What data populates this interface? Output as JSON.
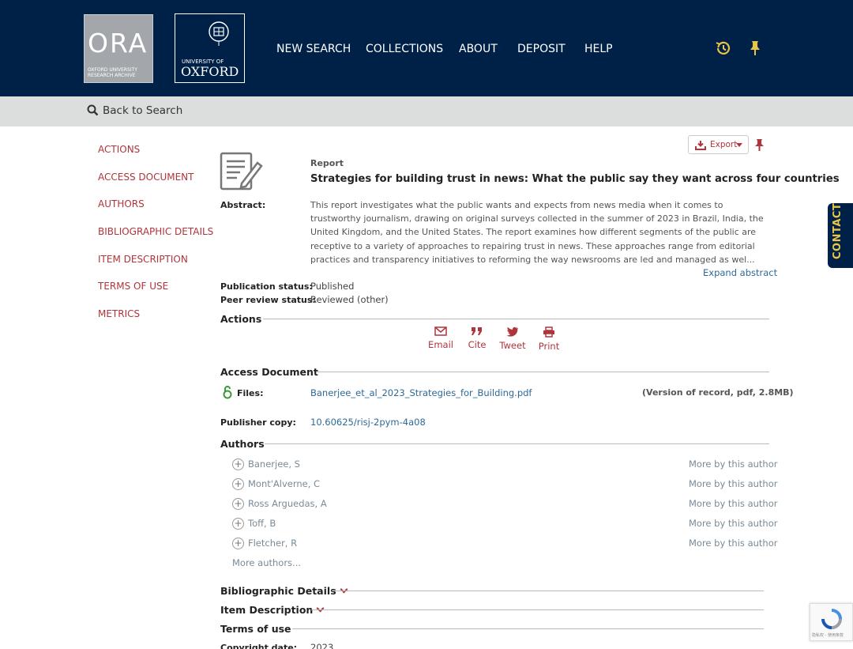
{
  "header": {
    "ora_logo_text": "ORA",
    "ora_logo_subtitle": "OXFORD UNIVERSITY RESEARCH ARCHIVE",
    "oxford_logo_small": "UNIVERSITY OF",
    "oxford_logo_big": "OXFORD",
    "nav": [
      "NEW SEARCH",
      "COLLECTIONS",
      "ABOUT",
      "DEPOSIT",
      "HELP"
    ],
    "icons": [
      "history-icon",
      "pin-icon"
    ],
    "colors": {
      "background": "#002147",
      "icon": "#e8c547"
    }
  },
  "backbar": {
    "label": "Back to Search"
  },
  "sidebar": {
    "items": [
      "ACTIONS",
      "ACCESS DOCUMENT",
      "AUTHORS",
      "BIBLIOGRAPHIC DETAILS",
      "ITEM DESCRIPTION",
      "TERMS OF USE",
      "METRICS"
    ]
  },
  "record": {
    "export_label": "Export",
    "type": "Report",
    "title": "Strategies for building trust in news: What the public say they want across four countries",
    "abstract_label": "Abstract:",
    "abstract": "This report investigates what the public wants and expects from news media when it comes to trustworthy journalism, drawing on original surveys collected in the summer of 2023 in Brazil, India, the United Kingdom, and the United States. The report examines how different segments of the public are receptive to a variety of approaches to repairing trust in news. These approaches range from editorial practices and transparency initiatives to reforming the way newsrooms are led and managed as wel...",
    "expand_abstract": "Expand abstract",
    "publication_status_label": "Publication status:",
    "publication_status": "Published",
    "peer_review_label": "Peer review status:",
    "peer_review": "Reviewed (other)"
  },
  "actions": {
    "heading": "Actions",
    "items": [
      "Email",
      "Cite",
      "Tweet",
      "Print"
    ]
  },
  "access": {
    "heading": "Access Document",
    "files_label": "Files:",
    "file_name": "Banerjee_et_al_2023_Strategies_for_Building.pdf",
    "file_meta": "(Version of record, pdf, 2.8MB)",
    "publisher_label": "Publisher copy:",
    "publisher_doi": "10.60625/risj-2pym-4a08"
  },
  "authors": {
    "heading": "Authors",
    "list": [
      "Banerjee, S",
      "Mont'Alverne, C",
      "Ross Arguedas, A",
      "Toff, B",
      "Fletcher, R"
    ],
    "more_by": "More by this author",
    "more_authors": "More authors..."
  },
  "sections": {
    "bibliographic": "Bibliographic Details",
    "item_description": "Item Description",
    "terms": "Terms of use",
    "copyright_label": "Copyright date:",
    "copyright_value": "2023"
  },
  "contact": {
    "label": "CONTACT"
  },
  "recaptcha": {
    "label": "隐私权 - 使用条款"
  },
  "colors": {
    "accent": "#b0343b",
    "link": "#2d6a96",
    "navy": "#002147"
  }
}
